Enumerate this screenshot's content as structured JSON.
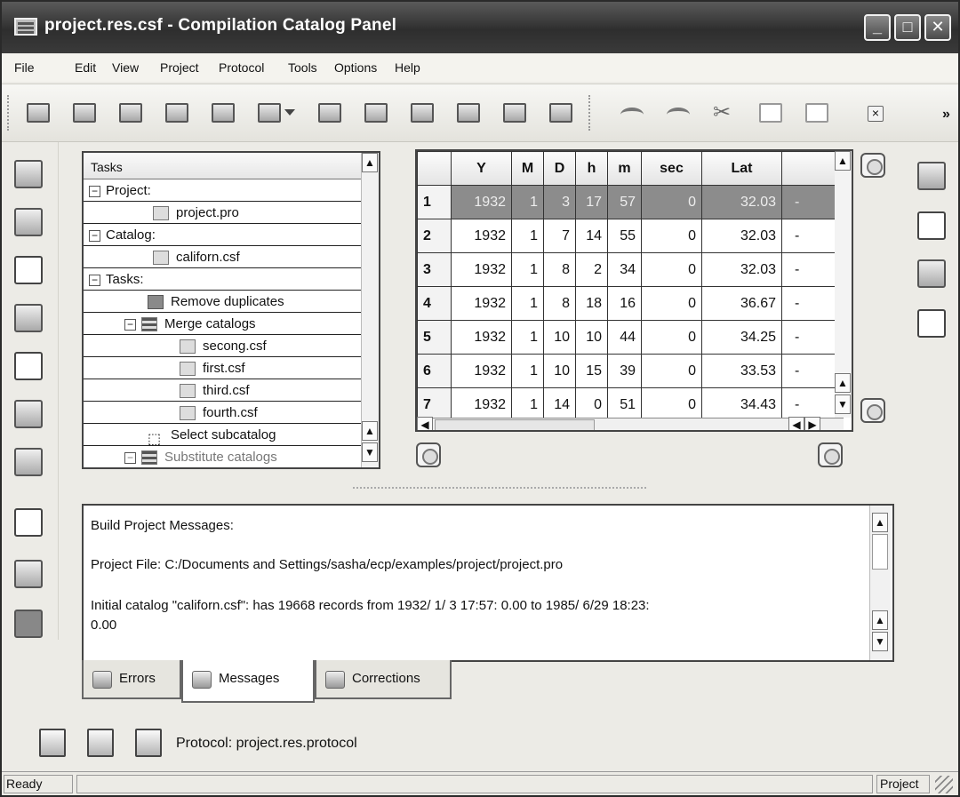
{
  "window": {
    "title": "project.res.csf - Compilation Catalog Panel",
    "minimize": "_",
    "maximize": "□",
    "close": "✕"
  },
  "menu": [
    "File",
    "Edit",
    "View",
    "Project",
    "Protocol",
    "Tools",
    "Options",
    "Help"
  ],
  "toolbar": {
    "icons": [
      "open-project-icon",
      "open-catalog-icon",
      "save-icon",
      "save-all-icon",
      "print-icon",
      "save-as-icon",
      "window-icon",
      "open-folder-icon",
      "edit-icon",
      "refresh-icon",
      "save-disk-icon",
      "save-disk-2-icon",
      "undo-icon",
      "redo-icon",
      "cut-icon",
      "copy-icon",
      "paste-icon",
      "delete-icon"
    ],
    "overflow": "»"
  },
  "tasks": {
    "header": "Tasks",
    "rows": [
      {
        "label": "Project:",
        "type": "group"
      },
      {
        "label": "project.pro",
        "type": "file"
      },
      {
        "label": "Catalog:",
        "type": "group"
      },
      {
        "label": "californ.csf",
        "type": "file"
      },
      {
        "label": "Tasks:",
        "type": "group"
      },
      {
        "label": "Remove duplicates",
        "type": "task"
      },
      {
        "label": "Merge catalogs",
        "type": "task-group"
      },
      {
        "label": "secong.csf",
        "type": "subfile"
      },
      {
        "label": "first.csf",
        "type": "subfile"
      },
      {
        "label": "third.csf",
        "type": "subfile"
      },
      {
        "label": "fourth.csf",
        "type": "subfile"
      },
      {
        "label": "Select subcatalog",
        "type": "task"
      },
      {
        "label": "Substitute catalogs",
        "type": "task-group"
      }
    ]
  },
  "grid": {
    "columns": [
      "",
      "Y",
      "M",
      "D",
      "h",
      "m",
      "sec",
      "Lat",
      ""
    ],
    "rows": [
      [
        "1",
        "1932",
        "1",
        "3",
        "17",
        "57",
        "0",
        "32.03",
        "-"
      ],
      [
        "2",
        "1932",
        "1",
        "7",
        "14",
        "55",
        "0",
        "32.03",
        "-"
      ],
      [
        "3",
        "1932",
        "1",
        "8",
        "2",
        "34",
        "0",
        "32.03",
        "-"
      ],
      [
        "4",
        "1932",
        "1",
        "8",
        "18",
        "16",
        "0",
        "36.67",
        "-"
      ],
      [
        "5",
        "1932",
        "1",
        "10",
        "10",
        "44",
        "0",
        "34.25",
        "-"
      ],
      [
        "6",
        "1932",
        "1",
        "10",
        "15",
        "39",
        "0",
        "33.53",
        "-"
      ],
      [
        "7",
        "1932",
        "1",
        "14",
        "0",
        "51",
        "0",
        "34.43",
        "-"
      ]
    ],
    "selected_row": 1
  },
  "messages": {
    "lines": [
      "Build Project Messages:",
      "Project File: C:/Documents and Settings/sasha/ecp/examples/project/project.pro",
      "Initial catalog \"californ.csf\":  has 19668 records from 1932/ 1/ 3 17:57: 0.00 to 1985/ 6/29 18:23:",
      "0.00"
    ]
  },
  "tabs": [
    "Errors",
    "Messages",
    "Corrections"
  ],
  "active_tab": "Messages",
  "protocol": {
    "label": "Protocol: project.res.protocol"
  },
  "status": {
    "left": "Ready",
    "right": "Project"
  }
}
